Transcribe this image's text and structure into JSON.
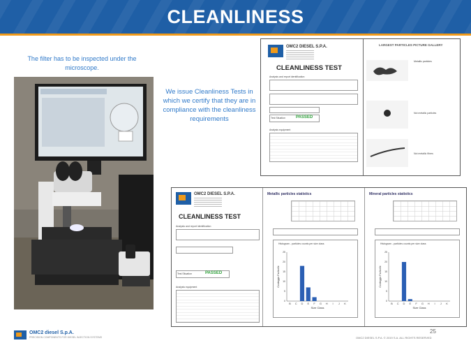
{
  "slide": {
    "title": "CLEANLINESS",
    "caption_left": "The filter has to be inspected under the microscope.",
    "caption_middle": "We issue Cleanliness Tests in which we certify that they are in compliance with the cleanliness requirements",
    "page_number": "25",
    "footer_brand": "OMC2 diesel S.p.A.",
    "footer_sub": "PRECISION COMPONENTS FOR DIESEL INJECTION SYSTEMS",
    "footer_right": "OMC2 DIESEL S.P.A. © 2019 S.A. ALL RIGHTS RESERVED"
  },
  "doc_top": {
    "company": "OMC2 DIESEL S.P.A.",
    "test_title": "CLEANLINESS TEST",
    "section1": "Analysis and report identification",
    "result_label": "Test Situation",
    "result_value": "PASSED",
    "section2": "Analysis equipment",
    "gallery_title": "LARGEST PARTICLES PICTURE GALLERY",
    "particle1": "Metallic particles",
    "particle2": "Not metallic particles",
    "particle3": "Not metallic fibres"
  },
  "doc_bottom": {
    "company": "OMC2 DIESEL S.P.A.",
    "test_title": "CLEANLINESS TEST",
    "section1": "Analysis and report identification",
    "result_label": "Test Situation",
    "result_value": "PASSED",
    "section2": "Analysis equipment",
    "metallic_title": "Metallic particles statistics",
    "mineral_title": "Mineral particles statistics",
    "chart_title": "Histogram - particles counts per size class",
    "ylabel": "Conteggio Particelle",
    "xlabel": "Size Class"
  },
  "chart_data": [
    {
      "type": "bar",
      "title": "Histogram - particles counts per size class",
      "xlabel": "Size Class",
      "ylabel": "Conteggio Particelle",
      "categories": [
        "B",
        "C",
        "D",
        "E",
        "F",
        "G",
        "H",
        "I",
        "J",
        "K"
      ],
      "values": [
        0,
        0,
        18,
        7,
        2,
        0,
        0,
        0,
        0,
        0
      ],
      "ylim": [
        0,
        25
      ]
    },
    {
      "type": "bar",
      "title": "Histogram - particles counts per size class",
      "xlabel": "Size Class",
      "ylabel": "Conteggio Particelle",
      "categories": [
        "B",
        "C",
        "D",
        "E",
        "F",
        "G",
        "H",
        "I",
        "J",
        "K"
      ],
      "values": [
        0,
        0,
        20,
        1,
        0,
        0,
        0,
        0,
        0,
        0
      ],
      "ylim": [
        0,
        25
      ]
    }
  ],
  "colors": {
    "banner": "#1f5fa6",
    "accent_line": "#f09a1a",
    "caption_text": "#2f79c9",
    "bar": "#2b5fb4",
    "passed": "#2fa13b"
  }
}
